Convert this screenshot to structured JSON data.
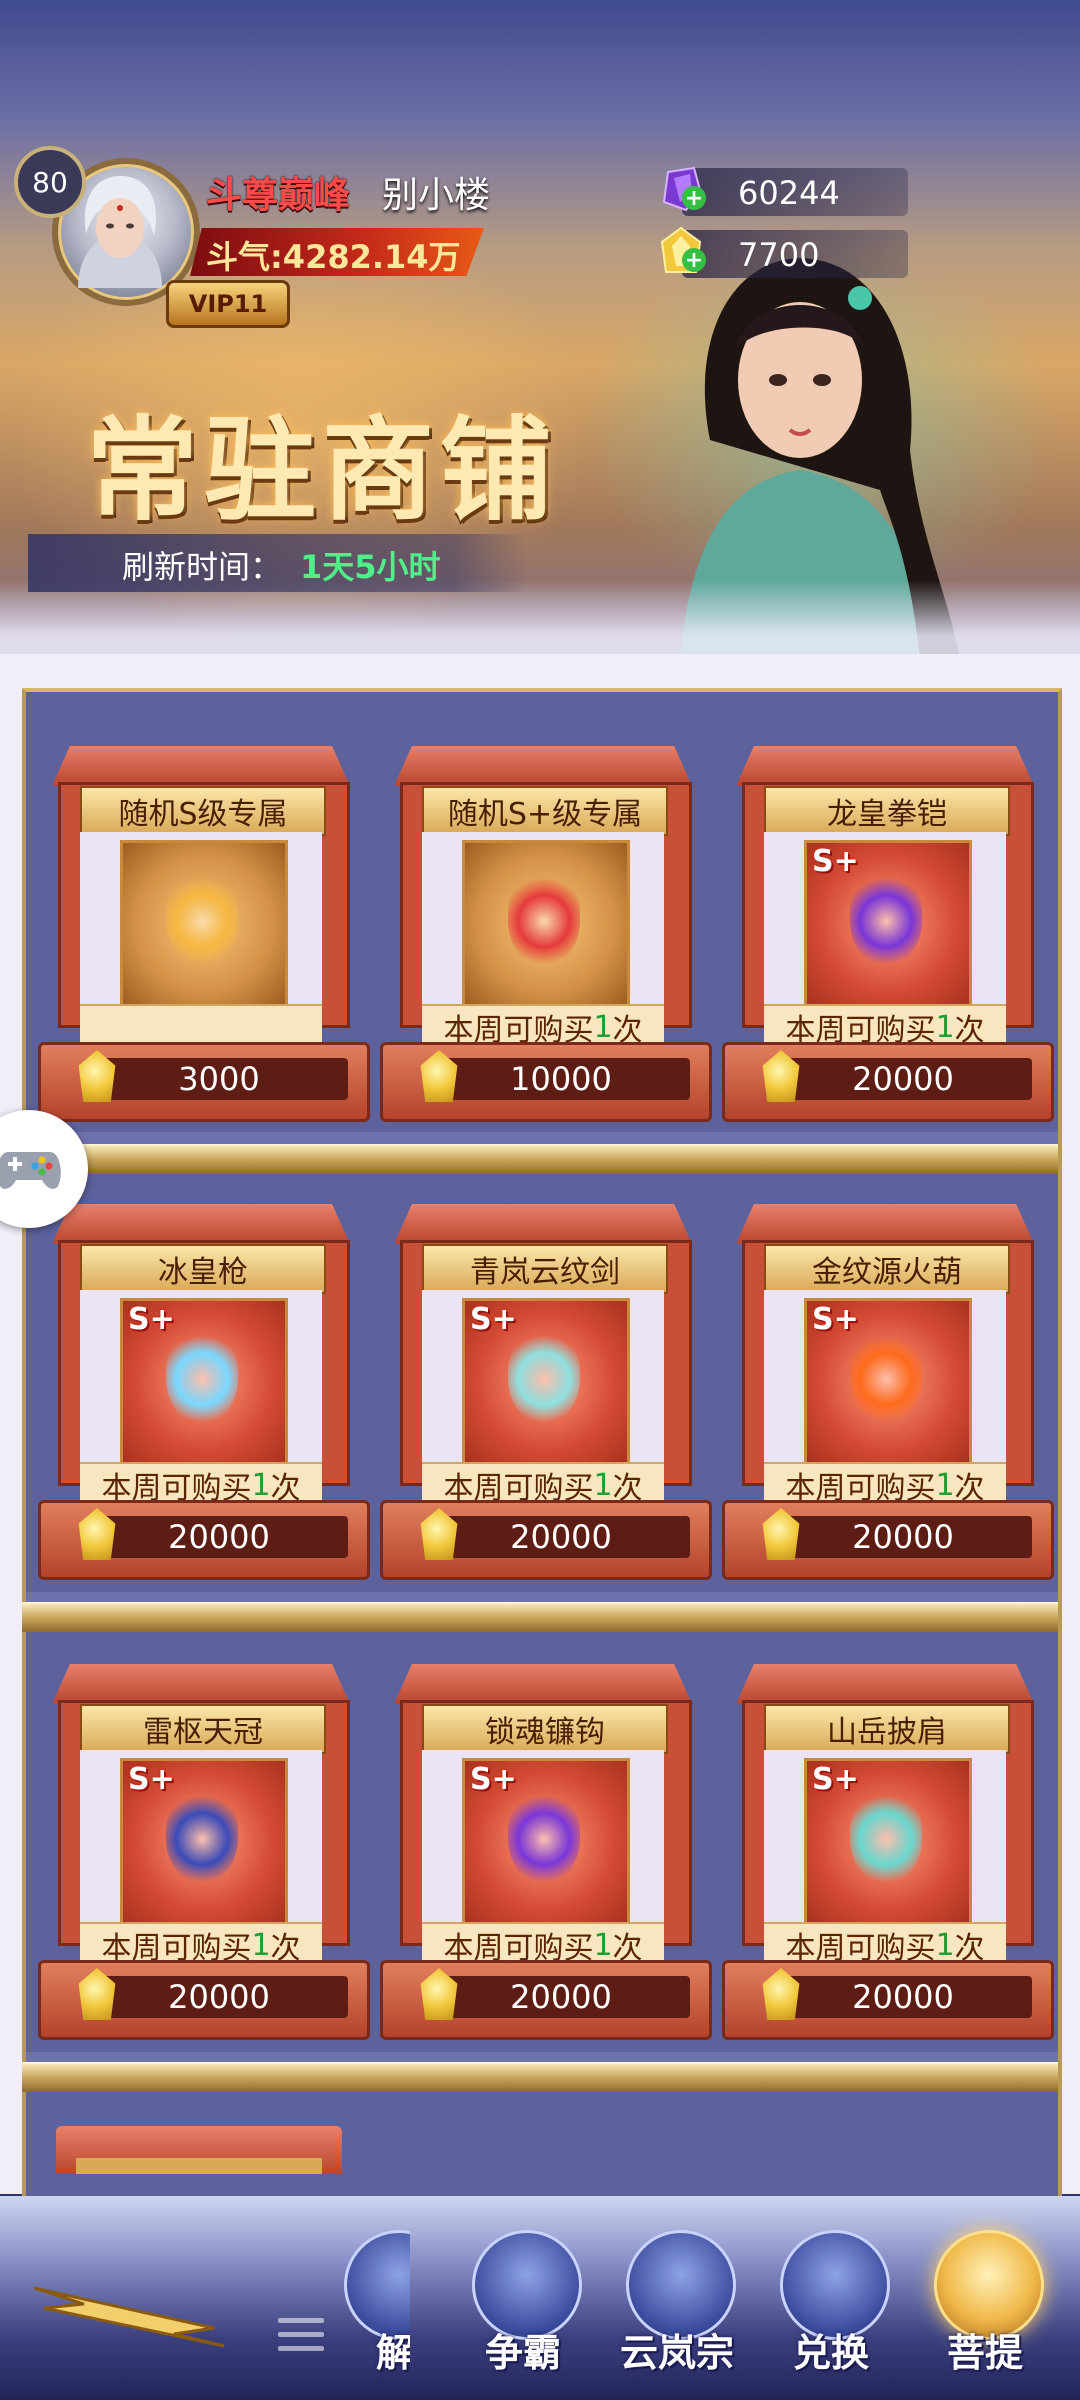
{
  "player": {
    "level": "80",
    "title": "斗尊巅峰",
    "name": "别小楼",
    "power": "斗气:4282.14万",
    "vip": "VIP11"
  },
  "currencies": [
    {
      "icon": "purple-crystal-icon",
      "value": "60244"
    },
    {
      "icon": "gold-crystal-icon",
      "value": "7700"
    }
  ],
  "shop": {
    "title": "常驻商铺",
    "refresh_label": "刷新时间：",
    "refresh_value": "1天5小时"
  },
  "items": [
    {
      "name": "随机S级专属",
      "limit_prefix": "",
      "limit_num": "",
      "limit_suffix": "",
      "price": "3000",
      "tier": ""
    },
    {
      "name": "随机S+级专属",
      "limit_prefix": "本周可购买",
      "limit_num": "1",
      "limit_suffix": "次",
      "price": "10000",
      "tier": ""
    },
    {
      "name": "龙皇拳铠",
      "limit_prefix": "本周可购买",
      "limit_num": "1",
      "limit_suffix": "次",
      "price": "20000",
      "tier": "S+"
    },
    {
      "name": "冰皇枪",
      "limit_prefix": "本周可购买",
      "limit_num": "1",
      "limit_suffix": "次",
      "price": "20000",
      "tier": "S+"
    },
    {
      "name": "青岚云纹剑",
      "limit_prefix": "本周可购买",
      "limit_num": "1",
      "limit_suffix": "次",
      "price": "20000",
      "tier": "S+"
    },
    {
      "name": "金纹源火葫",
      "limit_prefix": "本周可购买",
      "limit_num": "1",
      "limit_suffix": "次",
      "price": "20000",
      "tier": "S+"
    },
    {
      "name": "雷枢天冠",
      "limit_prefix": "本周可购买",
      "limit_num": "1",
      "limit_suffix": "次",
      "price": "20000",
      "tier": "S+"
    },
    {
      "name": "锁魂镰钩",
      "limit_prefix": "本周可购买",
      "limit_num": "1",
      "limit_suffix": "次",
      "price": "20000",
      "tier": "S+"
    },
    {
      "name": "山岳披肩",
      "limit_prefix": "本周可购买",
      "limit_num": "1",
      "limit_suffix": "次",
      "price": "20000",
      "tier": "S+"
    }
  ],
  "nav": [
    {
      "label": "解",
      "icon": "scroll-icon"
    },
    {
      "label": "争霸",
      "icon": "trophy-icon"
    },
    {
      "label": "云岚宗",
      "icon": "sect-gate-icon"
    },
    {
      "label": "兑换",
      "icon": "exchange-bag-icon"
    },
    {
      "label": "菩提",
      "icon": "bodhi-tree-icon",
      "active": true
    }
  ],
  "colors": {
    "accent_green": "#1f9f33",
    "title_red": "#ff4a4a",
    "refresh_green": "#4ff08a",
    "card_red": "#c84f38"
  }
}
